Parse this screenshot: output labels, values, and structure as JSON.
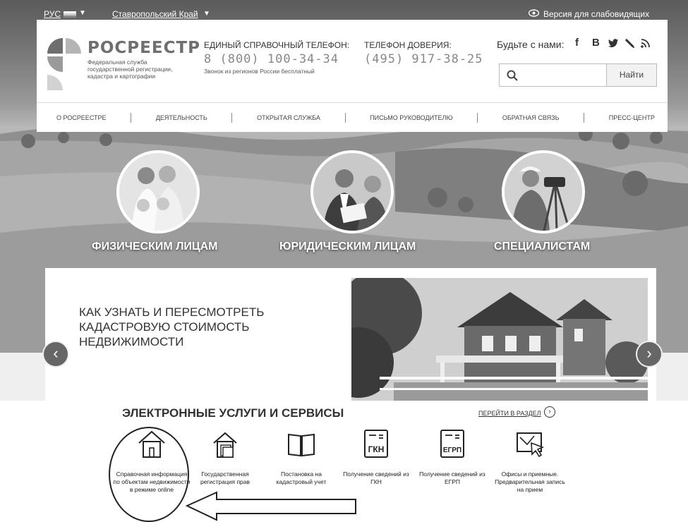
{
  "topbar": {
    "lang": "РУС",
    "region": "Ставропольский Край",
    "vision_link": "Версия для слабовидящих",
    "icons": [
      "flag-icon",
      "caret-down-icon",
      "eye-icon"
    ]
  },
  "header": {
    "brand": "РОСРЕЕСТР",
    "brand_sub": "Федеральная служба государственной регистрации, кадастра и картографии",
    "phone_label": "ЕДИНЫЙ СПРАВОЧНЫЙ ТЕЛЕФОН:",
    "phone_number": "8 (800) 100-34-34",
    "phone_note": "Звонок из регионов России бесплатный",
    "trust_label": "ТЕЛЕФОН ДОВЕРИЯ:",
    "trust_number": "(495) 917-38-25",
    "social_label": "Будьте с нами:",
    "social": [
      "f",
      "В",
      "twitter-icon",
      "lj-icon",
      "rss-icon"
    ],
    "search_placeholder": "",
    "search_button": "Найти"
  },
  "nav": {
    "items": [
      "О РОСРЕЕСТРЕ",
      "ДЕЯТЕЛЬНОСТЬ",
      "ОТКРЫТАЯ СЛУЖБА",
      "ПИСЬМО РУКОВОДИТЕЛЮ",
      "ОБРАТНАЯ СВЯЗЬ",
      "ПРЕСС-ЦЕНТР"
    ]
  },
  "audience": {
    "items": [
      "ФИЗИЧЕСКИМ ЛИЦАМ",
      "ЮРИДИЧЕСКИМ ЛИЦАМ",
      "СПЕЦИАЛИСТАМ"
    ]
  },
  "slide": {
    "title": "КАК УЗНАТЬ И ПЕРЕСМОТРЕТЬ КАДАСТРОВУЮ СТОИМОСТЬ НЕДВИЖИМОСТИ",
    "prev_icon": "chevron-left-icon",
    "next_icon": "chevron-right-icon"
  },
  "services": {
    "title": "ЭЛЕКТРОННЫЕ УСЛУГИ И СЕРВИСЫ",
    "goto": "ПЕРЕЙТИ В РАЗДЕЛ",
    "items": [
      {
        "label": "Справочная информация по объектам недвижимости в режиме online",
        "icon": "house-icon"
      },
      {
        "label": "Государственная регистрация прав",
        "icon": "house-docs-icon"
      },
      {
        "label": "Постановка на кадастровый учет",
        "icon": "book-icon"
      },
      {
        "label": "Получение сведений из ГКН",
        "icon": "document-icon",
        "badge": "ГКН"
      },
      {
        "label": "Получение сведений из ЕГРП",
        "icon": "document-icon",
        "badge": "ЕГРП"
      },
      {
        "label": "Офисы и приемные. Предварительная запись на прием",
        "icon": "map-cursor-icon"
      }
    ]
  }
}
